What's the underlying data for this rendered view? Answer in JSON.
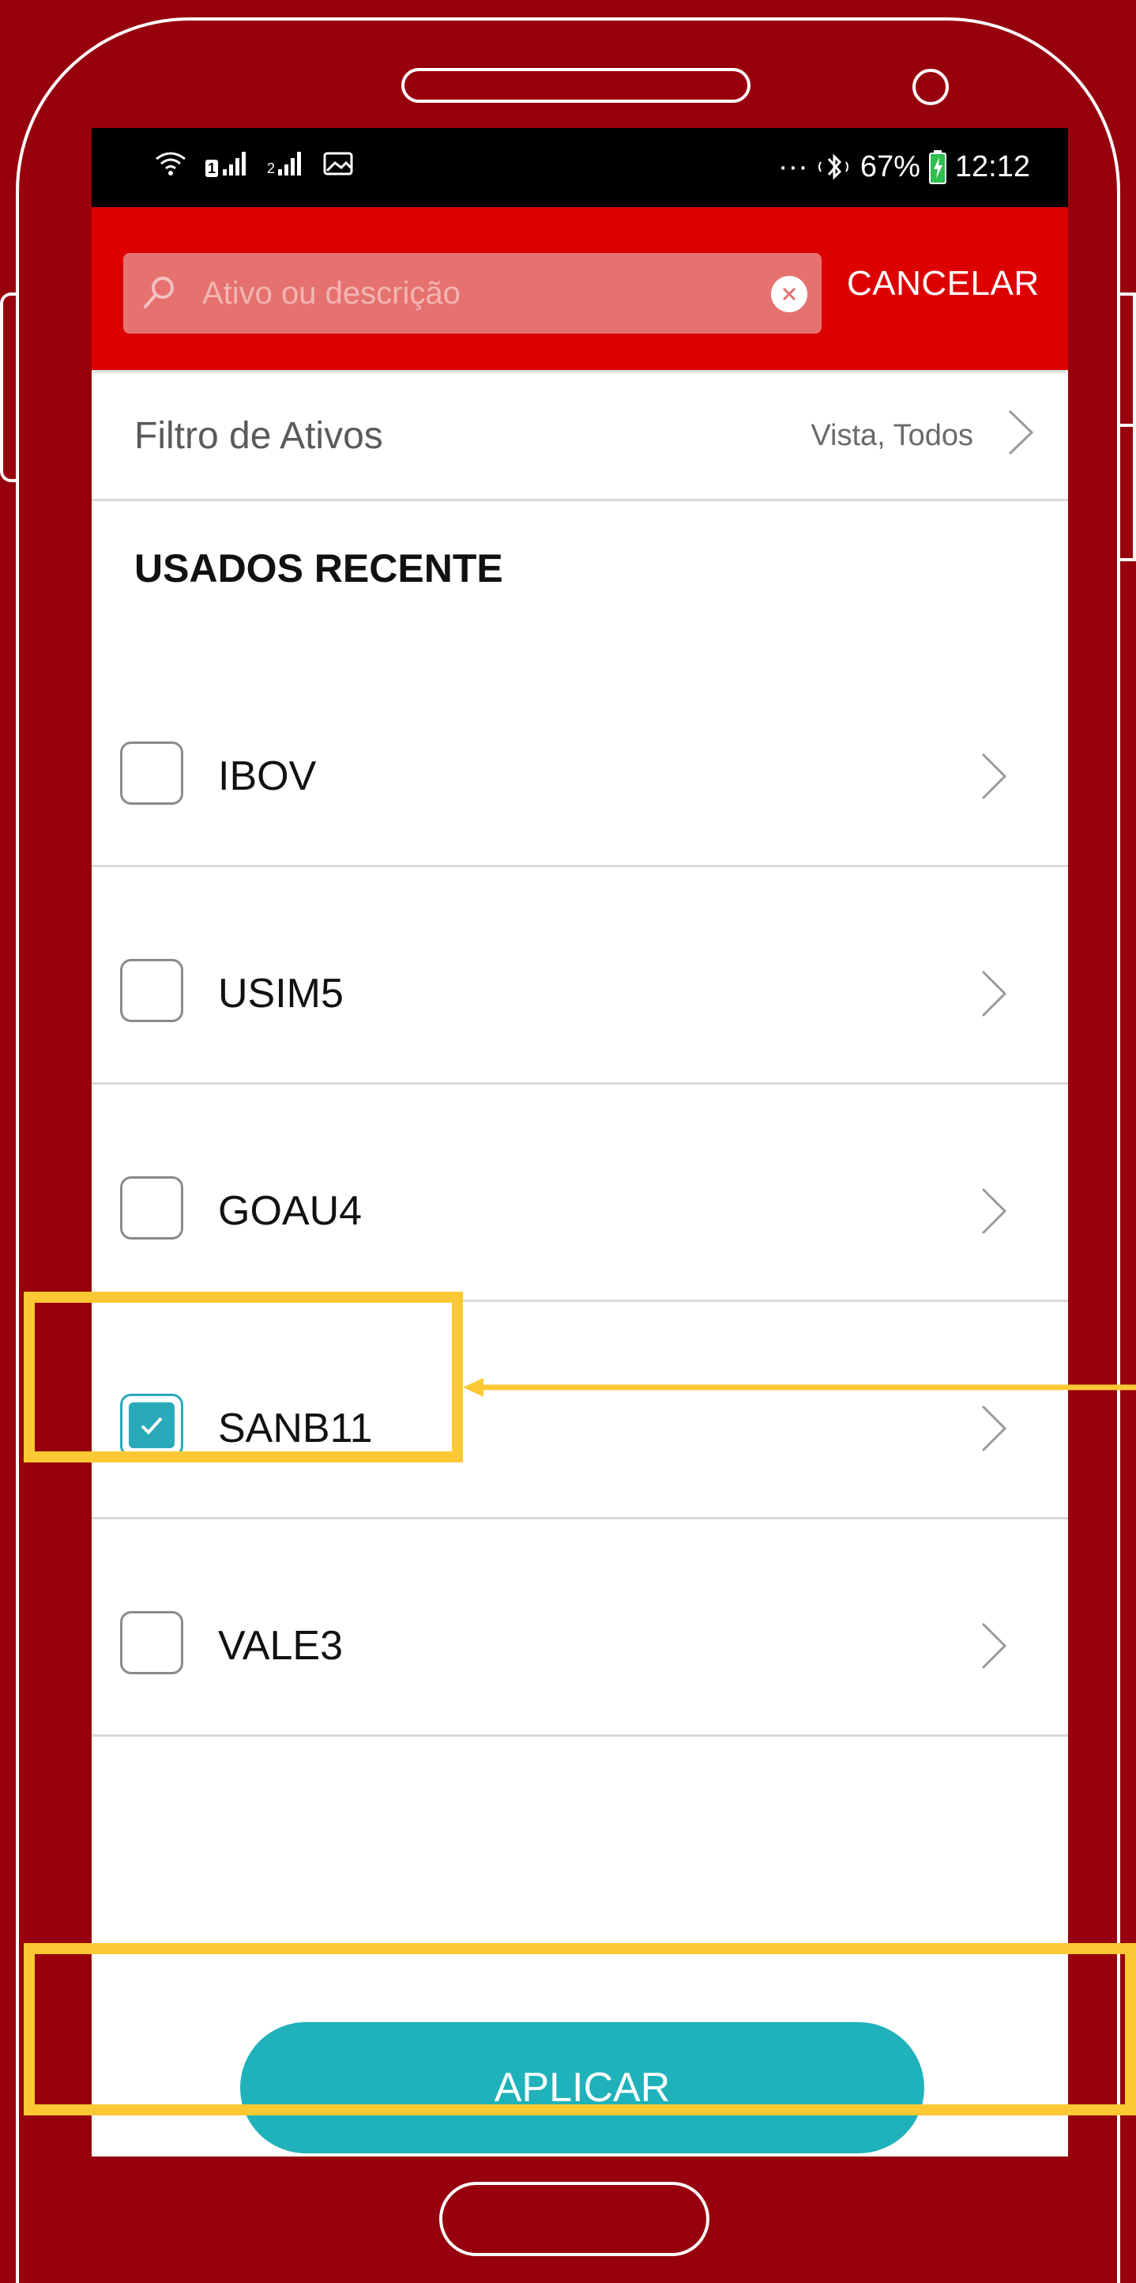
{
  "status_bar": {
    "sim1": "1",
    "sim2": "2",
    "more": "···",
    "battery": "67%",
    "time": "12:12"
  },
  "search": {
    "placeholder": "Ativo ou descrição",
    "value": "",
    "cancel_label": "CANCELAR"
  },
  "filter": {
    "title": "Filtro de Ativos",
    "value": "Vista, Todos"
  },
  "recent": {
    "section_title": "USADOS RECENTE",
    "items": [
      {
        "label": "IBOV",
        "checked": false
      },
      {
        "label": "USIM5",
        "checked": false
      },
      {
        "label": "GOAU4",
        "checked": false
      },
      {
        "label": "SANB11",
        "checked": true
      },
      {
        "label": "VALE3",
        "checked": false
      }
    ]
  },
  "apply_label": "APLICAR",
  "colors": {
    "frame": "#97000d",
    "header": "#dd0000",
    "accent": "#20b2ba",
    "highlight": "#fcc934"
  }
}
